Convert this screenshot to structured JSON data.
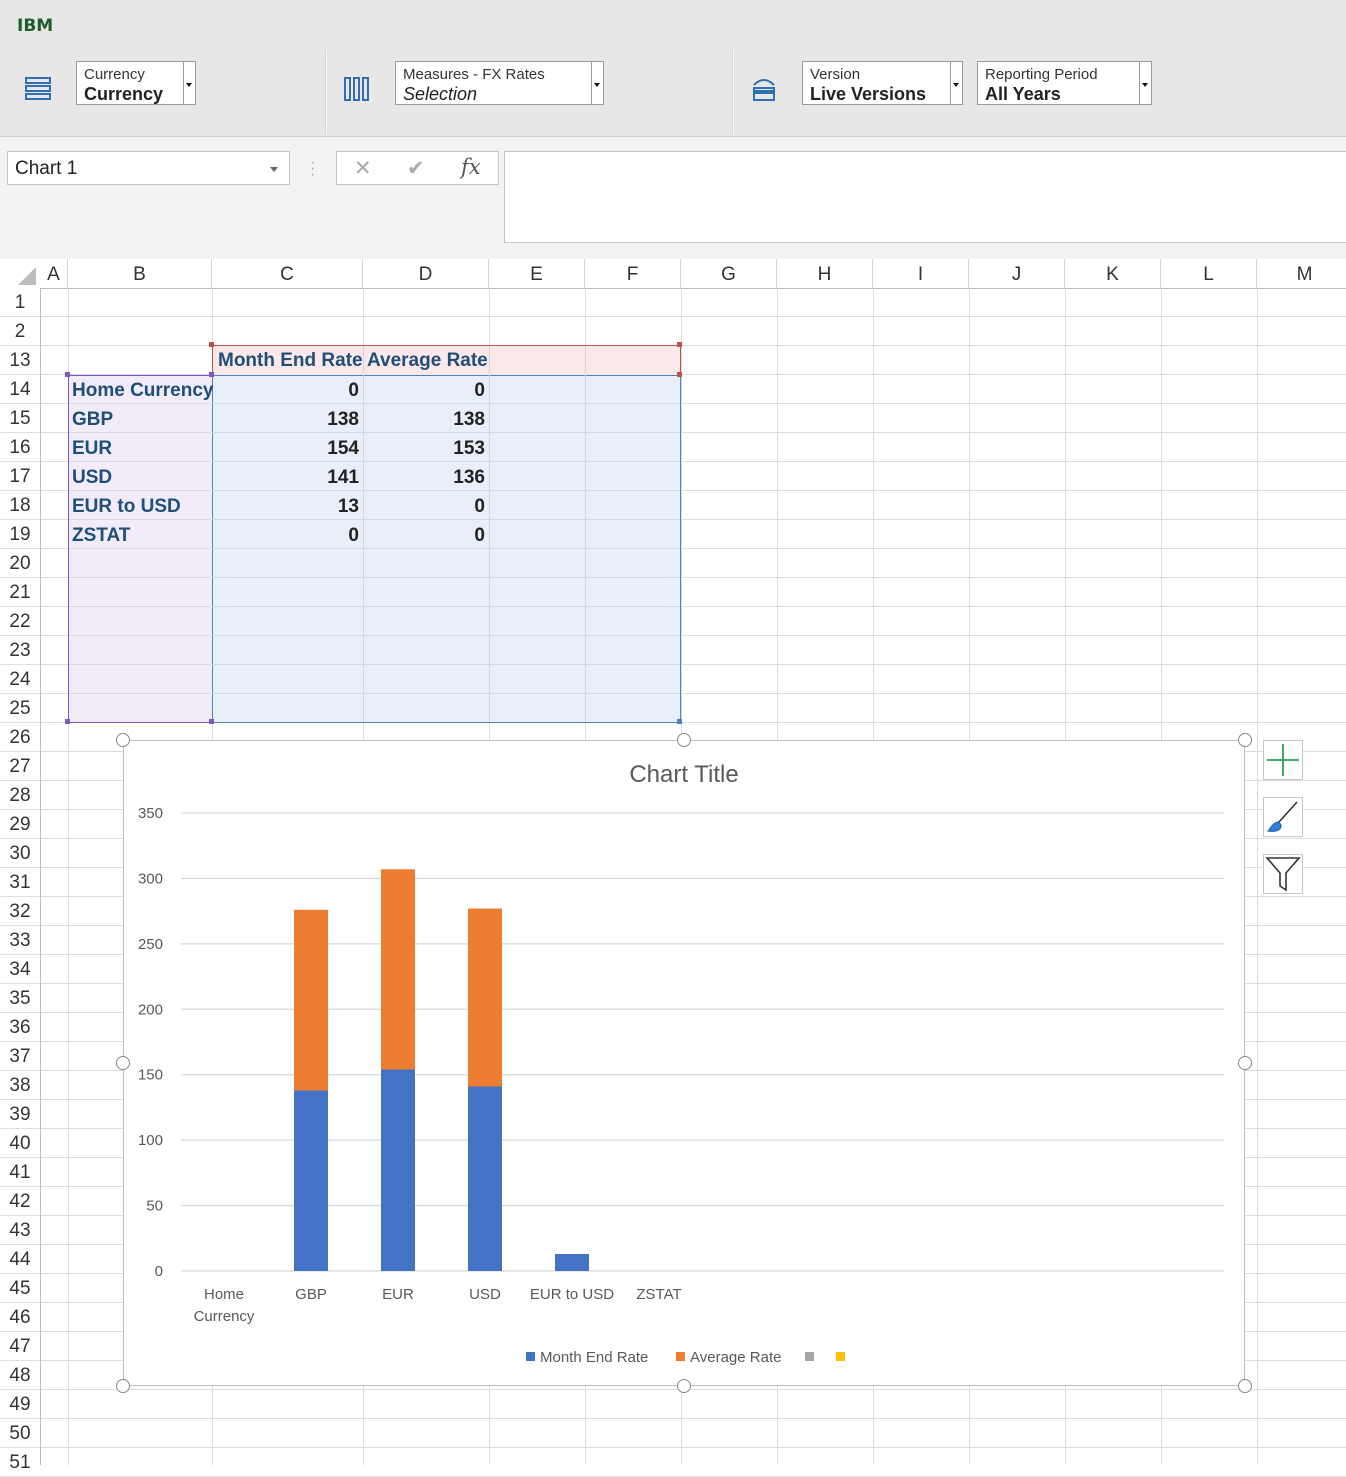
{
  "app": {
    "brand": "IBM"
  },
  "toolbar": {
    "dropdowns": [
      {
        "label": "Currency",
        "value": "Currency",
        "italic": false
      },
      {
        "label": "Measures - FX Rates",
        "value": "Selection",
        "italic": true
      },
      {
        "label": "Version",
        "value": "Live Versions",
        "italic": false
      },
      {
        "label": "Reporting Period",
        "value": "All Years",
        "italic": false
      }
    ]
  },
  "formula_bar": {
    "name_box": "Chart 1",
    "cancel_icon": "✕",
    "enter_icon": "✔",
    "fx": "fx",
    "formula": ""
  },
  "columns": [
    "A",
    "B",
    "C",
    "D",
    "E",
    "F",
    "G",
    "H",
    "I",
    "J",
    "K",
    "L",
    "M"
  ],
  "rows": [
    "1",
    "2",
    "13",
    "14",
    "15",
    "16",
    "17",
    "18",
    "19",
    "20",
    "21",
    "22",
    "23",
    "24",
    "25",
    "26",
    "27",
    "28",
    "29",
    "30",
    "31",
    "32",
    "33",
    "34",
    "35",
    "36",
    "37",
    "38",
    "39",
    "40",
    "41",
    "42",
    "43",
    "44",
    "45",
    "46",
    "47",
    "48",
    "49",
    "50",
    "51"
  ],
  "table": {
    "headers": [
      "Month End Rate",
      "Average Rate"
    ],
    "rows": [
      {
        "label": "Home Currency",
        "month_end": "0",
        "average": "0"
      },
      {
        "label": "GBP",
        "month_end": "138",
        "average": "138"
      },
      {
        "label": "EUR",
        "month_end": "154",
        "average": "153"
      },
      {
        "label": "USD",
        "month_end": "141",
        "average": "136"
      },
      {
        "label": "EUR to USD",
        "month_end": "13",
        "average": "0"
      },
      {
        "label": "ZSTAT",
        "month_end": "0",
        "average": "0"
      }
    ]
  },
  "colors": {
    "series1": "#4472c4",
    "series2": "#ed7d31",
    "series3": "#a5a5a5",
    "series4": "#ffc000",
    "brand": "#1d5d2d"
  },
  "chart_data": {
    "type": "bar",
    "stacked": true,
    "title": "Chart Title",
    "categories": [
      "Home Currency",
      "GBP",
      "EUR",
      "USD",
      "EUR to USD",
      "ZSTAT"
    ],
    "series": [
      {
        "name": "Month End Rate",
        "values": [
          0,
          138,
          154,
          141,
          13,
          0
        ]
      },
      {
        "name": "Average Rate",
        "values": [
          0,
          138,
          153,
          136,
          0,
          0
        ]
      }
    ],
    "legend": [
      "Month End Rate",
      "Average Rate",
      "",
      ""
    ],
    "yticks": [
      "0",
      "50",
      "100",
      "150",
      "200",
      "250",
      "300",
      "350"
    ],
    "ylim": [
      0,
      350
    ],
    "grid": true,
    "legend_position": "bottom"
  }
}
